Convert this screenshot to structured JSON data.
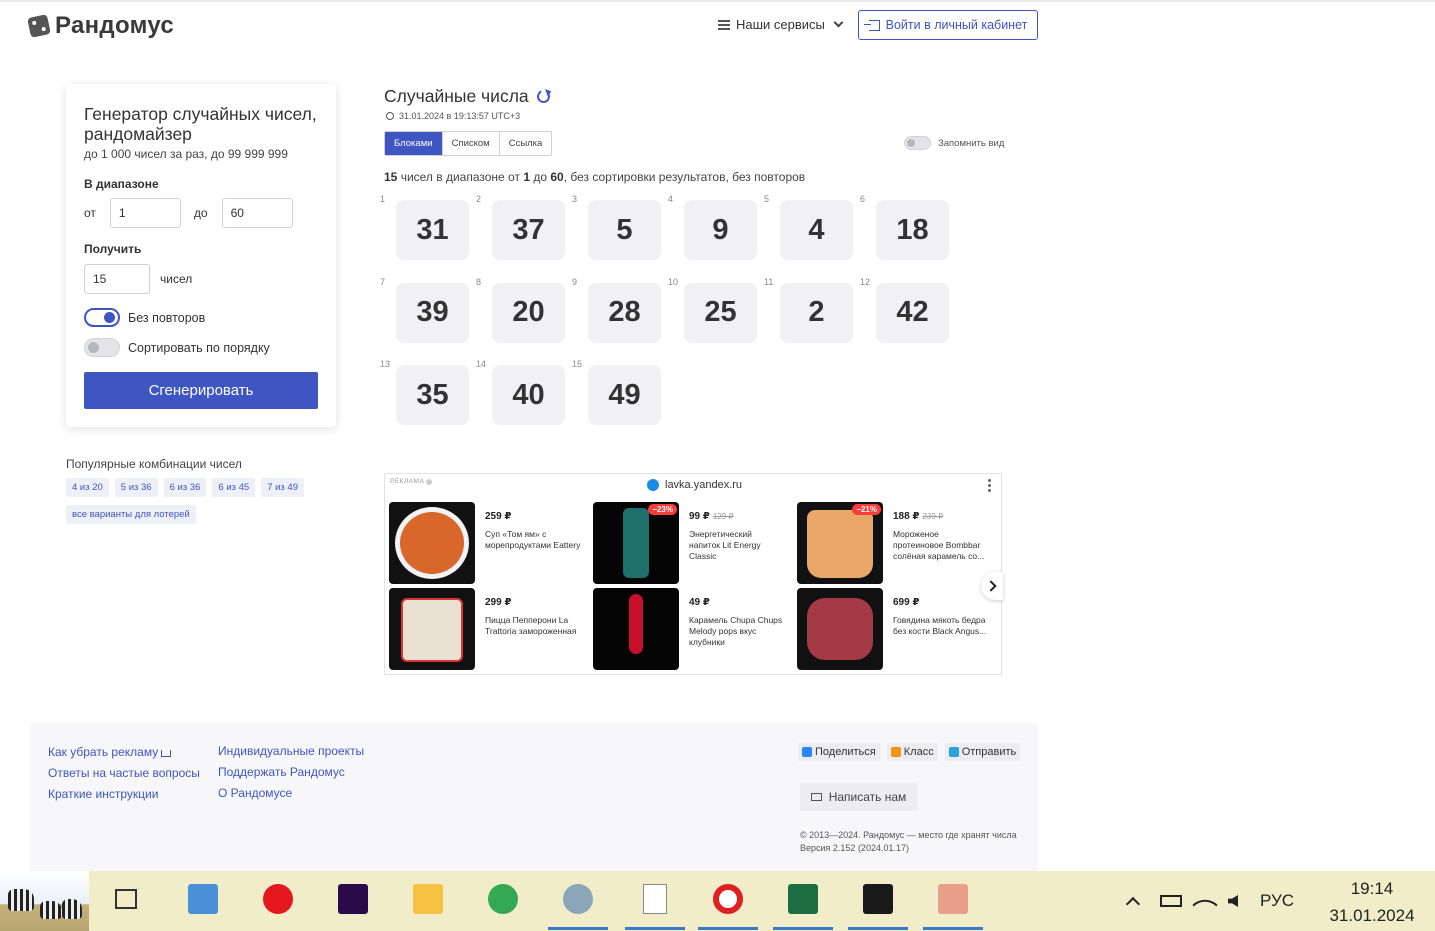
{
  "header": {
    "logo_text": "Рандомус",
    "services_label": "Наши сервисы",
    "login_label": "Войти в личный кабинет"
  },
  "form": {
    "title": "Генератор случайных чисел, рандомайзер",
    "subtitle": "до 1 000 чисел за раз, до 99 999 999",
    "range_label": "В диапазоне",
    "from_label": "от",
    "from_value": "1",
    "to_label": "до",
    "to_value": "60",
    "get_label": "Получить",
    "count_value": "15",
    "count_unit": "чисел",
    "no_repeat_label": "Без повторов",
    "no_repeat_on": true,
    "sort_label": "Сортировать по порядку",
    "sort_on": false,
    "generate_label": "Сгенерировать"
  },
  "popular": {
    "title": "Популярные комбинации чисел",
    "chips": [
      "4 из 20",
      "5 из 36",
      "6 из 36",
      "6 из 45",
      "7 из 49",
      "все варианты для лотерей"
    ]
  },
  "results": {
    "title": "Случайные числа",
    "timestamp": "31.01.2024 в 19:13:57 UTC+3",
    "tabs": [
      "Блоками",
      "Списком",
      "Ссылка"
    ],
    "active_tab": "Блоками",
    "remember_label": "Запомнить вид",
    "summary_count": "15",
    "summary_a": " чисел в диапазоне от ",
    "summary_from": "1",
    "summary_b": " до ",
    "summary_to": "60",
    "summary_c": ", без сортировки результатов, без повторов",
    "numbers": [
      {
        "idx": "1",
        "value": "31"
      },
      {
        "idx": "2",
        "value": "37"
      },
      {
        "idx": "3",
        "value": "5"
      },
      {
        "idx": "4",
        "value": "9"
      },
      {
        "idx": "5",
        "value": "4"
      },
      {
        "idx": "6",
        "value": "18"
      },
      {
        "idx": "7",
        "value": "39"
      },
      {
        "idx": "8",
        "value": "20"
      },
      {
        "idx": "9",
        "value": "28"
      },
      {
        "idx": "10",
        "value": "25"
      },
      {
        "idx": "11",
        "value": "2"
      },
      {
        "idx": "12",
        "value": "42"
      },
      {
        "idx": "13",
        "value": "35"
      },
      {
        "idx": "14",
        "value": "40"
      },
      {
        "idx": "15",
        "value": "49"
      }
    ]
  },
  "ad": {
    "label": "РЕКЛАМА",
    "domain": "lavka.yandex.ru",
    "products": [
      {
        "price": "259 ₽",
        "old_price": "",
        "discount": "",
        "name": "Суп «Том ям» с морепродуктами Eattery",
        "color": "#d9662b"
      },
      {
        "price": "99 ₽",
        "old_price": "129 ₽",
        "discount": "−23%",
        "name": "Энергетический напиток Lit Energy Classic",
        "color": "#1f6f6a"
      },
      {
        "price": "188 ₽",
        "old_price": "239 ₽",
        "discount": "−21%",
        "name": "Мороженое протеиновое Bombbar солёная карамель со...",
        "color": "#e9a86a"
      },
      {
        "price": "299 ₽",
        "old_price": "",
        "discount": "",
        "name": "Пицца Пепперони La Trattoria замороженная",
        "color": "#c8b79a"
      },
      {
        "price": "49 ₽",
        "old_price": "",
        "discount": "",
        "name": "Карамель Chupa Chups Melody pops вкус клубники",
        "color": "#c8102e"
      },
      {
        "price": "699 ₽",
        "old_price": "",
        "discount": "",
        "name": "Говядина мякоть бедра без кости Black Angus...",
        "color": "#a33a45"
      }
    ]
  },
  "footer": {
    "links_col1": [
      "Как убрать рекламу",
      "Ответы на частые вопросы",
      "Краткие инструкции"
    ],
    "links_col2": [
      "Индивидуальные проекты",
      "Поддержать Рандомус",
      "О Рандомусе"
    ],
    "share": [
      {
        "label": "Поделиться",
        "icon": "vk-icon",
        "color": "#2787f5"
      },
      {
        "label": "Класс",
        "icon": "ok-icon",
        "color": "#f7931e"
      },
      {
        "label": "Отправить",
        "icon": "telegram-icon",
        "color": "#2aa3df"
      }
    ],
    "write_label": "Написать нам",
    "copyright": "© 2013—2024. Рандомус — место где хранят числа",
    "version": "Версия 2.152 (2024.01.17)"
  },
  "taskbar": {
    "apps": [
      "task-view-icon",
      "snipping-tool-icon",
      "opera-icon",
      "premiere-pro-icon",
      "file-explorer-icon",
      "chrome-icon",
      "app-icon",
      "office-365-file-icon",
      "yandex-browser-icon",
      "excel-icon",
      "sticky-notes-icon",
      "magnifier-icon"
    ],
    "language": "РУС",
    "time": "19:14",
    "date": "31.01.2024"
  }
}
